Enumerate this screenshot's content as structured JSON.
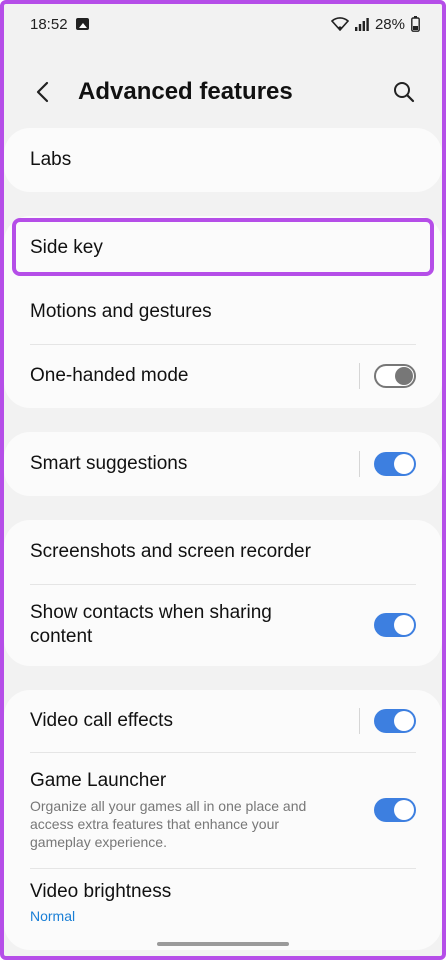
{
  "status": {
    "time": "18:52",
    "battery": "28%"
  },
  "header": {
    "title": "Advanced features"
  },
  "cards": {
    "labs": {
      "title": "Labs"
    },
    "side_key": {
      "title": "Side key"
    },
    "motions": {
      "title": "Motions and gestures"
    },
    "one_handed": {
      "title": "One-handed mode",
      "toggle": false
    },
    "smart_suggestions": {
      "title": "Smart suggestions",
      "toggle": true
    },
    "screenshots": {
      "title": "Screenshots and screen recorder"
    },
    "show_contacts": {
      "title": "Show contacts when sharing content",
      "toggle": true
    },
    "video_call": {
      "title": "Video call effects",
      "toggle": true
    },
    "game_launcher": {
      "title": "Game Launcher",
      "subtitle": "Organize all your games all in one place and access extra features that enhance your gameplay experience.",
      "toggle": true
    },
    "video_brightness": {
      "title": "Video brightness",
      "value": "Normal"
    }
  },
  "colors": {
    "accent_toggle": "#3d7fe0",
    "highlight": "#b54ee8",
    "value_text": "#1a7fd6"
  }
}
